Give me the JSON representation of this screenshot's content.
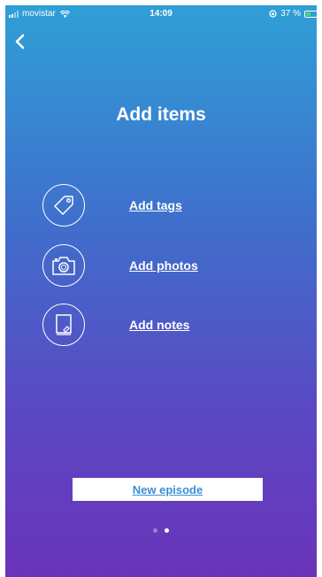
{
  "status_bar": {
    "carrier": "movistar",
    "time": "14:09",
    "battery_text": "37 %",
    "battery_level": 0.37,
    "battery_color": "#4cd964"
  },
  "nav": {
    "back_icon": "chevron-left-icon"
  },
  "page": {
    "title": "Add items"
  },
  "items": [
    {
      "label": "Add tags",
      "icon": "tag-icon"
    },
    {
      "label": "Add photos",
      "icon": "camera-icon"
    },
    {
      "label": "Add notes",
      "icon": "notepad-icon"
    }
  ],
  "new_episode_button": {
    "label": "New episode",
    "text_color": "#3c8fd6"
  },
  "pager": {
    "page_count": 2,
    "current_page": 2
  },
  "colors": {
    "gradient_top": "#2f9fd6",
    "gradient_bottom": "#6a34b9"
  }
}
